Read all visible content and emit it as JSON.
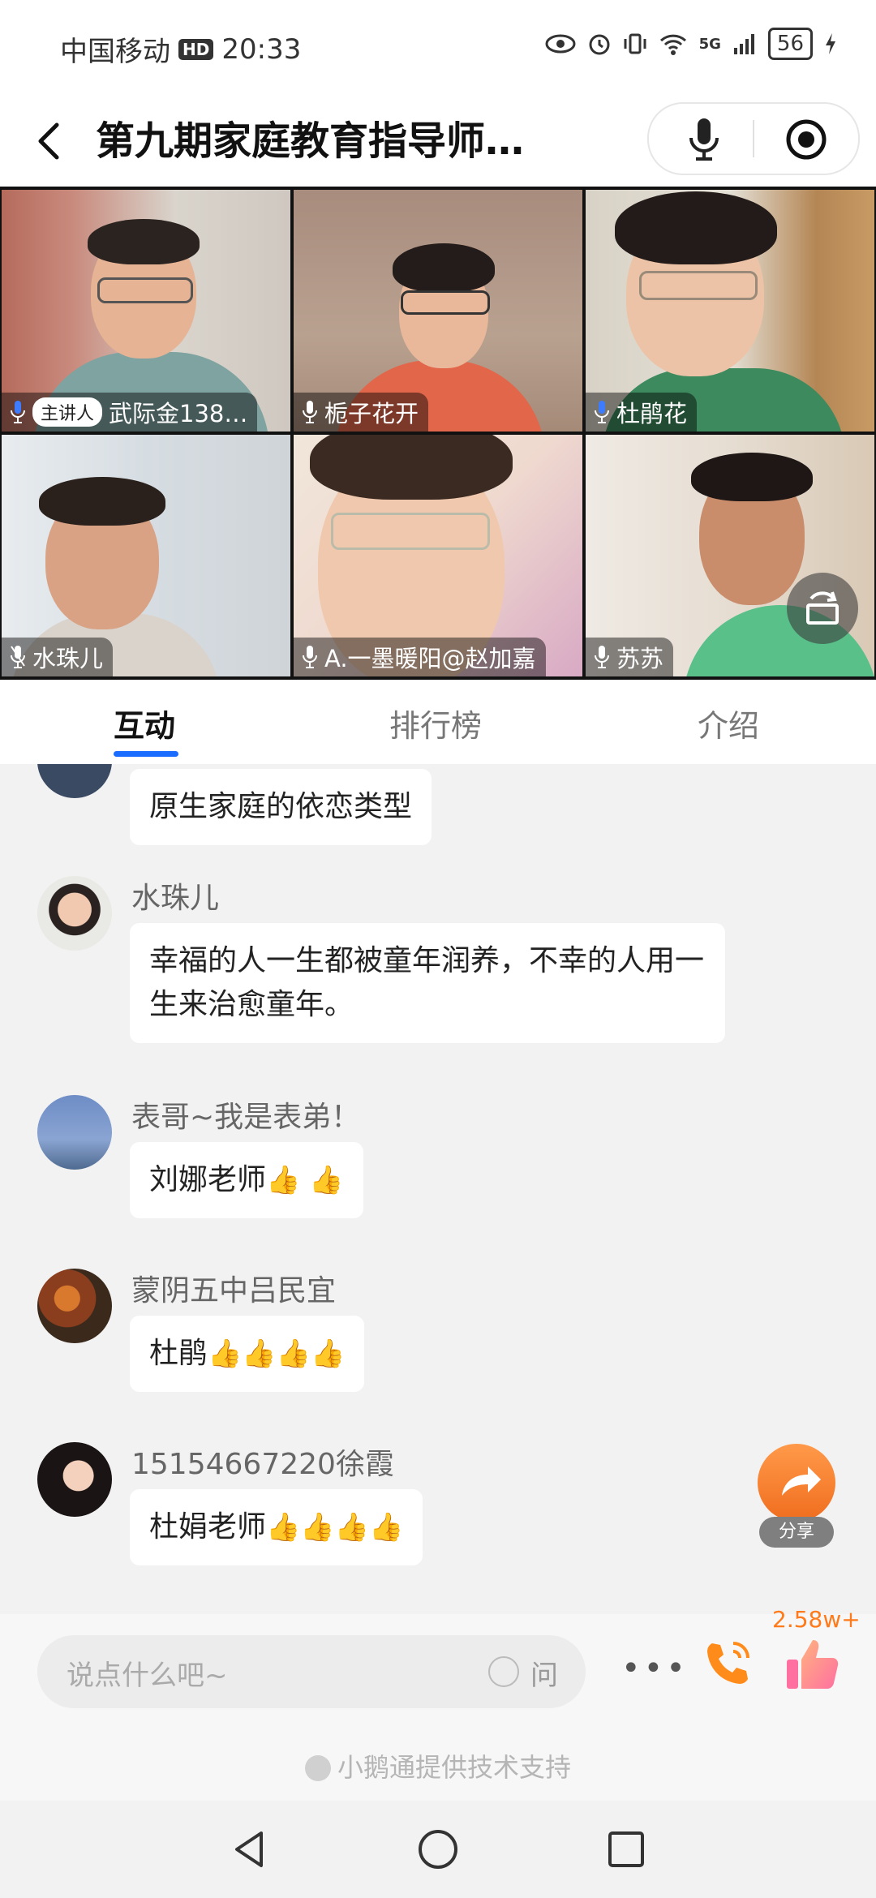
{
  "status_bar": {
    "carrier": "中国移动",
    "hd": "HD",
    "time": "20:33",
    "signal": "5G",
    "battery": "56"
  },
  "header": {
    "title": "第九期家庭教育指导师…"
  },
  "participants": [
    {
      "name": "武际金138…",
      "host_label": "主讲人"
    },
    {
      "name": "栀子花开"
    },
    {
      "name": "杜鹃花"
    },
    {
      "name": "水珠儿"
    },
    {
      "name": "A.一墨暖阳@赵加嘉"
    },
    {
      "name": "苏苏"
    }
  ],
  "tabs": [
    {
      "label": "互动"
    },
    {
      "label": "排行榜"
    },
    {
      "label": "介绍"
    }
  ],
  "messages": [
    {
      "user": "",
      "text": "原生家庭的依恋类型"
    },
    {
      "user": "水珠儿",
      "text": "幸福的人一生都被童年润养，不幸的人用一生来治愈童年。"
    },
    {
      "user": "表哥~我是表弟！",
      "text": "刘娜老师",
      "emoji": "👍 👍"
    },
    {
      "user": "蒙阴五中吕民宜",
      "text": "杜鹃",
      "emoji": "👍👍👍👍"
    },
    {
      "user": "15154667220徐霞",
      "text": "杜娟老师",
      "emoji": "👍👍👍👍"
    }
  ],
  "share": {
    "label": "分享"
  },
  "bottom_bar": {
    "input_placeholder": "说点什么吧~",
    "ask_label": "问",
    "more": "•••",
    "like_count": "2.58w+",
    "support_text": "小鹅通提供技术支持"
  },
  "colors": {
    "accent": "#1a6dff",
    "like": "#ff7a1a"
  }
}
